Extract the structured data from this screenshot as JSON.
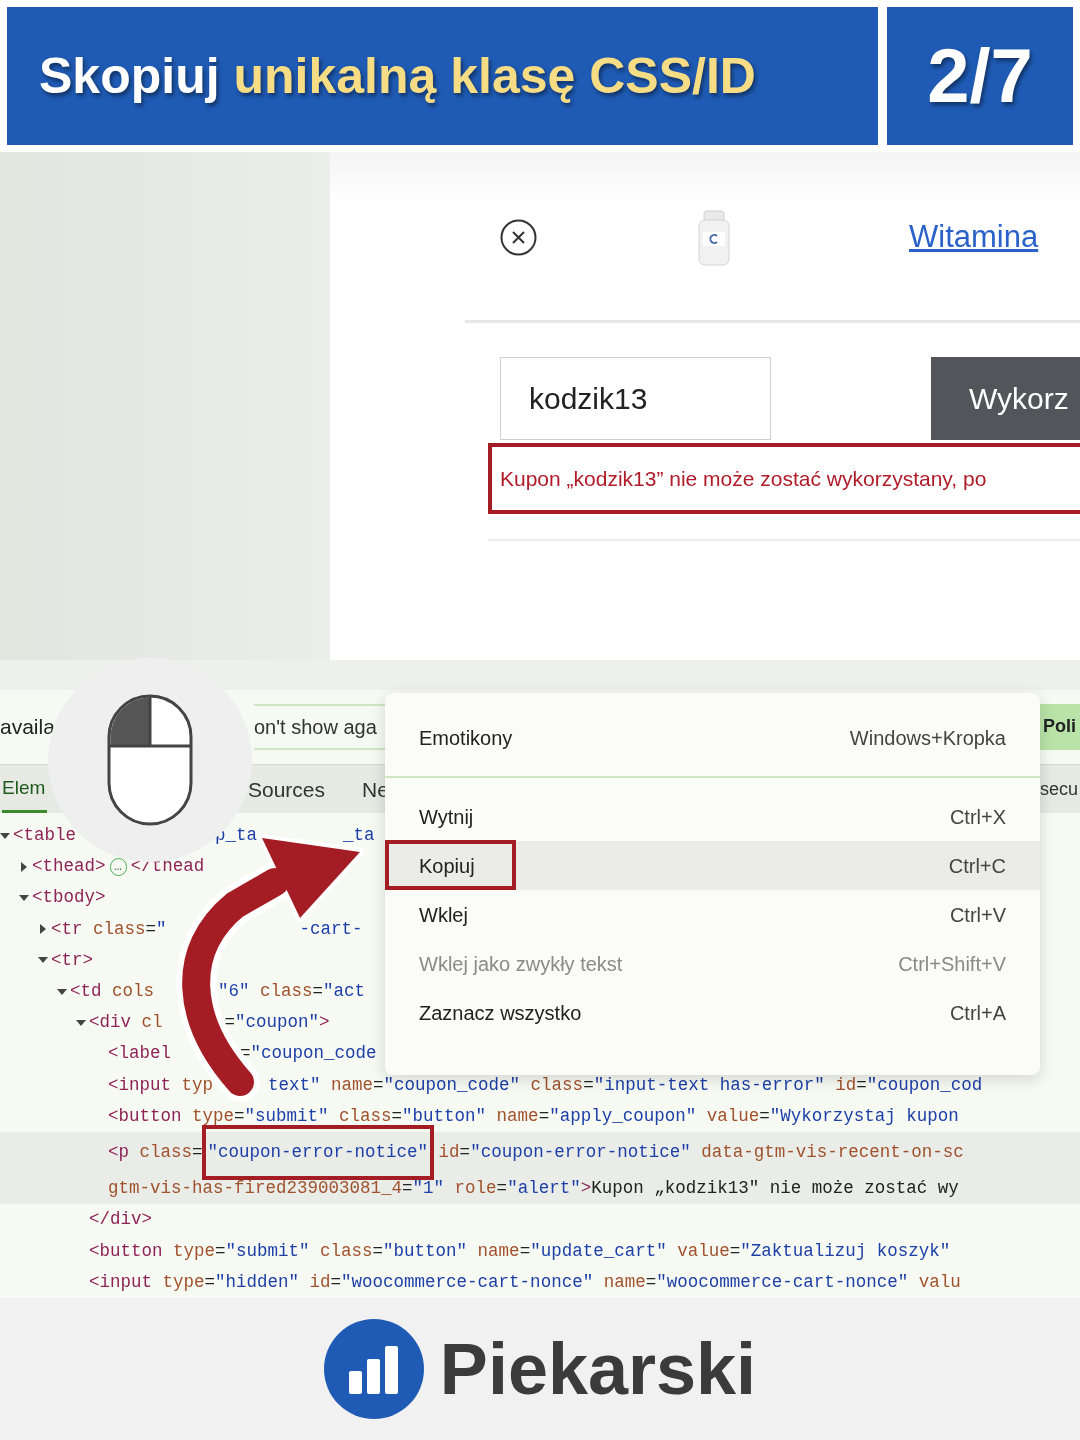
{
  "header": {
    "title_lead": "Skopiuj",
    "title_highlight": "unikalną klasę CSS/ID",
    "counter": "2/7"
  },
  "page": {
    "product_link": "Witamina",
    "coupon_value": "kodzik13",
    "apply_button": "Wykorz",
    "error_message": "Kupon „kodzik13” nie może zostać wykorzystany, po"
  },
  "devtools": {
    "notice_text": "availa",
    "notice_button": "on't show aga",
    "notice_link": "Poli",
    "tabs": [
      {
        "label": "Elem",
        "selected": true
      },
      {
        "label": "Sources",
        "selected": false
      },
      {
        "label": "Ne",
        "selected": false
      }
    ],
    "tab_right": "secu",
    "lines": [
      {
        "expanded": true,
        "selected": false,
        "parts": [
          {
            "framed": false,
            "tokens": [
              {
                "kind": "tag",
                "text": "<table"
              }
            ]
          },
          {
            "framed": false,
            "tokens": [
              {
                "kind": "value",
                "text": "p_ta"
              }
            ]
          },
          {
            "framed": false,
            "tokens": [
              {
                "kind": "value",
                "text": "_ta"
              }
            ]
          }
        ]
      },
      {
        "expanded": false,
        "selected": false,
        "parts": [
          {
            "framed": false,
            "tokens": [
              {
                "kind": "tag",
                "text": "<thead>"
              },
              {
                "kind": "badge",
                "text": "…"
              },
              {
                "kind": "tag",
                "text": "</thead"
              }
            ]
          }
        ]
      },
      {
        "expanded": true,
        "selected": false,
        "parts": [
          {
            "framed": false,
            "tokens": [
              {
                "kind": "tag",
                "text": "<tbody>"
              }
            ]
          }
        ]
      },
      {
        "expanded": false,
        "selected": false,
        "parts": [
          {
            "framed": false,
            "tokens": [
              {
                "kind": "tag",
                "text": "<tr"
              },
              {
                "kind": "attr",
                "text": " class"
              },
              {
                "kind": "plain",
                "text": "="
              },
              {
                "kind": "value",
                "text": "\""
              }
            ]
          },
          {
            "framed": false,
            "tokens": [
              {
                "kind": "value",
                "text": "-cart-"
              }
            ]
          }
        ]
      },
      {
        "expanded": true,
        "selected": false,
        "parts": [
          {
            "framed": false,
            "tokens": [
              {
                "kind": "tag",
                "text": "<tr>"
              }
            ]
          }
        ]
      },
      {
        "expanded": true,
        "selected": false,
        "parts": [
          {
            "framed": false,
            "tokens": [
              {
                "kind": "tag",
                "text": "<td"
              },
              {
                "kind": "attr",
                "text": " cols"
              }
            ]
          },
          {
            "framed": false,
            "tokens": [
              {
                "kind": "value",
                "text": "\"6\""
              },
              {
                "kind": "attr",
                "text": " class"
              },
              {
                "kind": "plain",
                "text": "="
              },
              {
                "kind": "value",
                "text": "\"act"
              }
            ]
          }
        ]
      },
      {
        "expanded": true,
        "selected": false,
        "parts": [
          {
            "framed": false,
            "tokens": [
              {
                "kind": "tag",
                "text": "<div"
              },
              {
                "kind": "attr",
                "text": " cl"
              }
            ]
          },
          {
            "framed": false,
            "tokens": [
              {
                "kind": "plain",
                "text": "="
              },
              {
                "kind": "value",
                "text": "\"coupon\""
              },
              {
                "kind": "tag",
                "text": ">"
              }
            ]
          }
        ]
      },
      {
        "selected": false,
        "parts": [
          {
            "framed": false,
            "tokens": [
              {
                "kind": "tag",
                "text": "<label"
              }
            ]
          },
          {
            "framed": false,
            "tokens": [
              {
                "kind": "plain",
                "text": "="
              },
              {
                "kind": "value",
                "text": "\"coupon_code"
              }
            ]
          }
        ]
      },
      {
        "selected": false,
        "parts": [
          {
            "framed": false,
            "tokens": [
              {
                "kind": "tag",
                "text": "<input"
              },
              {
                "kind": "attr",
                "text": " typ"
              }
            ]
          },
          {
            "framed": false,
            "tokens": [
              {
                "kind": "value",
                "text": "text\""
              },
              {
                "kind": "attr",
                "text": " name"
              },
              {
                "kind": "plain",
                "text": "="
              },
              {
                "kind": "value",
                "text": "\"coupon_code\""
              },
              {
                "kind": "attr",
                "text": " class"
              },
              {
                "kind": "plain",
                "text": "="
              },
              {
                "kind": "value",
                "text": "\"input-text has-error\""
              },
              {
                "kind": "attr",
                "text": " id"
              },
              {
                "kind": "plain",
                "text": "="
              },
              {
                "kind": "value",
                "text": "\"coupon_cod"
              }
            ]
          }
        ]
      },
      {
        "selected": false,
        "parts": [
          {
            "framed": false,
            "tokens": [
              {
                "kind": "tag",
                "text": "<button"
              },
              {
                "kind": "attr",
                "text": " type"
              },
              {
                "kind": "plain",
                "text": "="
              },
              {
                "kind": "value",
                "text": "\"submit\""
              },
              {
                "kind": "attr",
                "text": " class"
              },
              {
                "kind": "plain",
                "text": "="
              },
              {
                "kind": "value",
                "text": "\"button\""
              },
              {
                "kind": "attr",
                "text": " name"
              },
              {
                "kind": "plain",
                "text": "="
              },
              {
                "kind": "value",
                "text": "\"apply_coupon\""
              },
              {
                "kind": "attr",
                "text": " value"
              },
              {
                "kind": "plain",
                "text": "="
              },
              {
                "kind": "value",
                "text": "\"Wykorzystaj kupon"
              }
            ]
          }
        ]
      },
      {
        "selected": true,
        "parts": [
          {
            "framed": false,
            "tokens": [
              {
                "kind": "tag",
                "text": "<p"
              },
              {
                "kind": "attr",
                "text": " class"
              },
              {
                "kind": "plain",
                "text": "="
              }
            ]
          },
          {
            "framed": true,
            "tokens": [
              {
                "kind": "value",
                "text": "\"coupon-error-notice\""
              }
            ]
          },
          {
            "framed": false,
            "tokens": [
              {
                "kind": "attr",
                "text": " id"
              },
              {
                "kind": "plain",
                "text": "="
              },
              {
                "kind": "value",
                "text": "\"coupon-error-notice\""
              },
              {
                "kind": "attr",
                "text": " data-gtm-vis-recent-on-sc"
              }
            ]
          }
        ]
      },
      {
        "selected": true,
        "parts": [
          {
            "framed": false,
            "tokens": [
              {
                "kind": "attr",
                "text": "gtm-vis-has-fired239003081_4"
              },
              {
                "kind": "plain",
                "text": "="
              },
              {
                "kind": "value",
                "text": "\"1\""
              },
              {
                "kind": "attr",
                "text": " role"
              },
              {
                "kind": "plain",
                "text": "="
              },
              {
                "kind": "value",
                "text": "\"alert\""
              },
              {
                "kind": "tag",
                "text": ">"
              },
              {
                "kind": "plain",
                "text": "Kupon „kodzik13\" nie może zostać wy"
              }
            ]
          }
        ]
      },
      {
        "selected": false,
        "parts": [
          {
            "framed": false,
            "tokens": [
              {
                "kind": "tag",
                "text": "</div>"
              }
            ]
          }
        ]
      },
      {
        "selected": false,
        "parts": [
          {
            "framed": false,
            "tokens": [
              {
                "kind": "tag",
                "text": "<button"
              },
              {
                "kind": "attr",
                "text": " type"
              },
              {
                "kind": "plain",
                "text": "="
              },
              {
                "kind": "value",
                "text": "\"submit\""
              },
              {
                "kind": "attr",
                "text": " class"
              },
              {
                "kind": "plain",
                "text": "="
              },
              {
                "kind": "value",
                "text": "\"button\""
              },
              {
                "kind": "attr",
                "text": " name"
              },
              {
                "kind": "plain",
                "text": "="
              },
              {
                "kind": "value",
                "text": "\"update_cart\""
              },
              {
                "kind": "attr",
                "text": " value"
              },
              {
                "kind": "plain",
                "text": "="
              },
              {
                "kind": "value",
                "text": "\"Zaktualizuj koszyk\""
              }
            ]
          }
        ]
      },
      {
        "selected": false,
        "parts": [
          {
            "framed": false,
            "tokens": [
              {
                "kind": "tag",
                "text": "<input"
              },
              {
                "kind": "attr",
                "text": " type"
              },
              {
                "kind": "plain",
                "text": "="
              },
              {
                "kind": "value",
                "text": "\"hidden\""
              },
              {
                "kind": "attr",
                "text": " id"
              },
              {
                "kind": "plain",
                "text": "="
              },
              {
                "kind": "value",
                "text": "\"woocommerce-cart-nonce\""
              },
              {
                "kind": "attr",
                "text": " name"
              },
              {
                "kind": "plain",
                "text": "="
              },
              {
                "kind": "value",
                "text": "\"woocommerce-cart-nonce\""
              },
              {
                "kind": "attr",
                "text": " valu"
              }
            ]
          }
        ]
      }
    ]
  },
  "context_menu": {
    "items": [
      {
        "label": "Emotikony",
        "shortcut": "Windows+Kropka",
        "selected": false,
        "disabled": false
      },
      {
        "label": "Wytnij",
        "shortcut": "Ctrl+X",
        "selected": false,
        "disabled": false
      },
      {
        "label": "Kopiuj",
        "shortcut": "Ctrl+C",
        "selected": true,
        "disabled": false
      },
      {
        "label": "Wklej",
        "shortcut": "Ctrl+V",
        "selected": false,
        "disabled": false
      },
      {
        "label": "Wklej jako zwykły tekst",
        "shortcut": "Ctrl+Shift+V",
        "selected": false,
        "disabled": true
      },
      {
        "label": "Zaznacz wszystko",
        "shortcut": "Ctrl+A",
        "selected": false,
        "disabled": false
      }
    ]
  },
  "footer": {
    "brand": "Piekarski"
  }
}
